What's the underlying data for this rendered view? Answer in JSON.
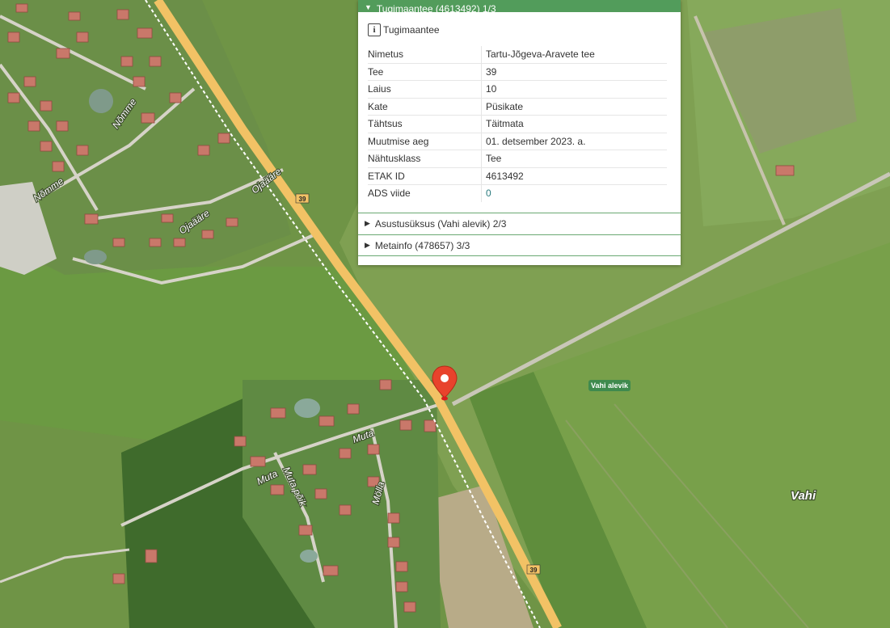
{
  "panel": {
    "header_title": "Tugimaantee (4613492) 1/3",
    "feature_type": "Tugimaantee",
    "attributes": [
      {
        "key": "Nimetus",
        "value": "Tartu-Jõgeva-Aravete tee"
      },
      {
        "key": "Tee",
        "value": "39"
      },
      {
        "key": "Laius",
        "value": "10"
      },
      {
        "key": "Kate",
        "value": "Püsikate"
      },
      {
        "key": "Tähtsus",
        "value": "Täitmata"
      },
      {
        "key": "Muutmise aeg",
        "value": "01. detsember 2023. a."
      },
      {
        "key": "Nähtusklass",
        "value": "Tee"
      },
      {
        "key": "ETAK ID",
        "value": "4613492"
      },
      {
        "key": "ADS viide",
        "value": "0"
      }
    ],
    "sections": [
      {
        "label": "Asustusüksus (Vahi alevik) 2/3"
      },
      {
        "label": "Metainfo (478657) 3/3"
      }
    ]
  },
  "map": {
    "labels": {
      "nomme_1": "Nõmme",
      "nomme_2": "Nõmme",
      "ojaaare_1": "Ojaääre",
      "ojaaare_2": "Ojaääre",
      "muta_1": "Muta",
      "muta_2": "Muta",
      "muta_poik": "Muta põik",
      "molla": "Mölla",
      "town": "Vahi",
      "area_pill": "Vahi alevik",
      "road_badge_1": "39",
      "road_badge_2": "39"
    },
    "colors": {
      "road": "#f2c265",
      "marker": "#e8432c",
      "panel_header": "#529c5b",
      "area_pill": "#3f8a4e"
    }
  }
}
